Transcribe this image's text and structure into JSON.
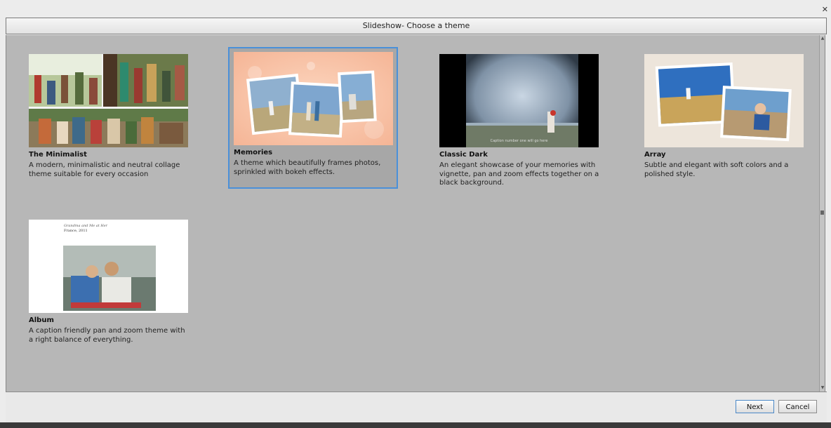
{
  "dialog": {
    "title": "Slideshow- Choose a theme",
    "close_glyph": "✕"
  },
  "themes": [
    {
      "name": "The Minimalist",
      "description": "A modern, minimalistic and neutral collage theme suitable for every occasion",
      "selected": false
    },
    {
      "name": "Memories",
      "description": "A theme which beautifully frames photos, sprinkled with bokeh effects.",
      "selected": true
    },
    {
      "name": "Classic Dark",
      "description": "An elegant showcase of your memories with vignette, pan and zoom effects together on a black background.",
      "caption": "Caption number one will go here",
      "selected": false
    },
    {
      "name": "Array",
      "description": "Subtle and elegant with soft colors and a polished style.",
      "selected": false
    },
    {
      "name": "Album",
      "description": "A caption friendly pan and zoom theme with a right balance of everything.",
      "caption_line1": "Grandma and Me at Her",
      "caption_line2": "France, 2011",
      "selected": false
    }
  ],
  "footer": {
    "next_label": "Next",
    "cancel_label": "Cancel"
  },
  "colors": {
    "selection_border": "#4a90d9",
    "panel_background": "#b7b7b7",
    "memories_background": "#f8c4a8"
  },
  "icons": {
    "close": "close-icon",
    "scroll_up": "scroll-up-icon",
    "scroll_down": "scroll-down-icon"
  }
}
